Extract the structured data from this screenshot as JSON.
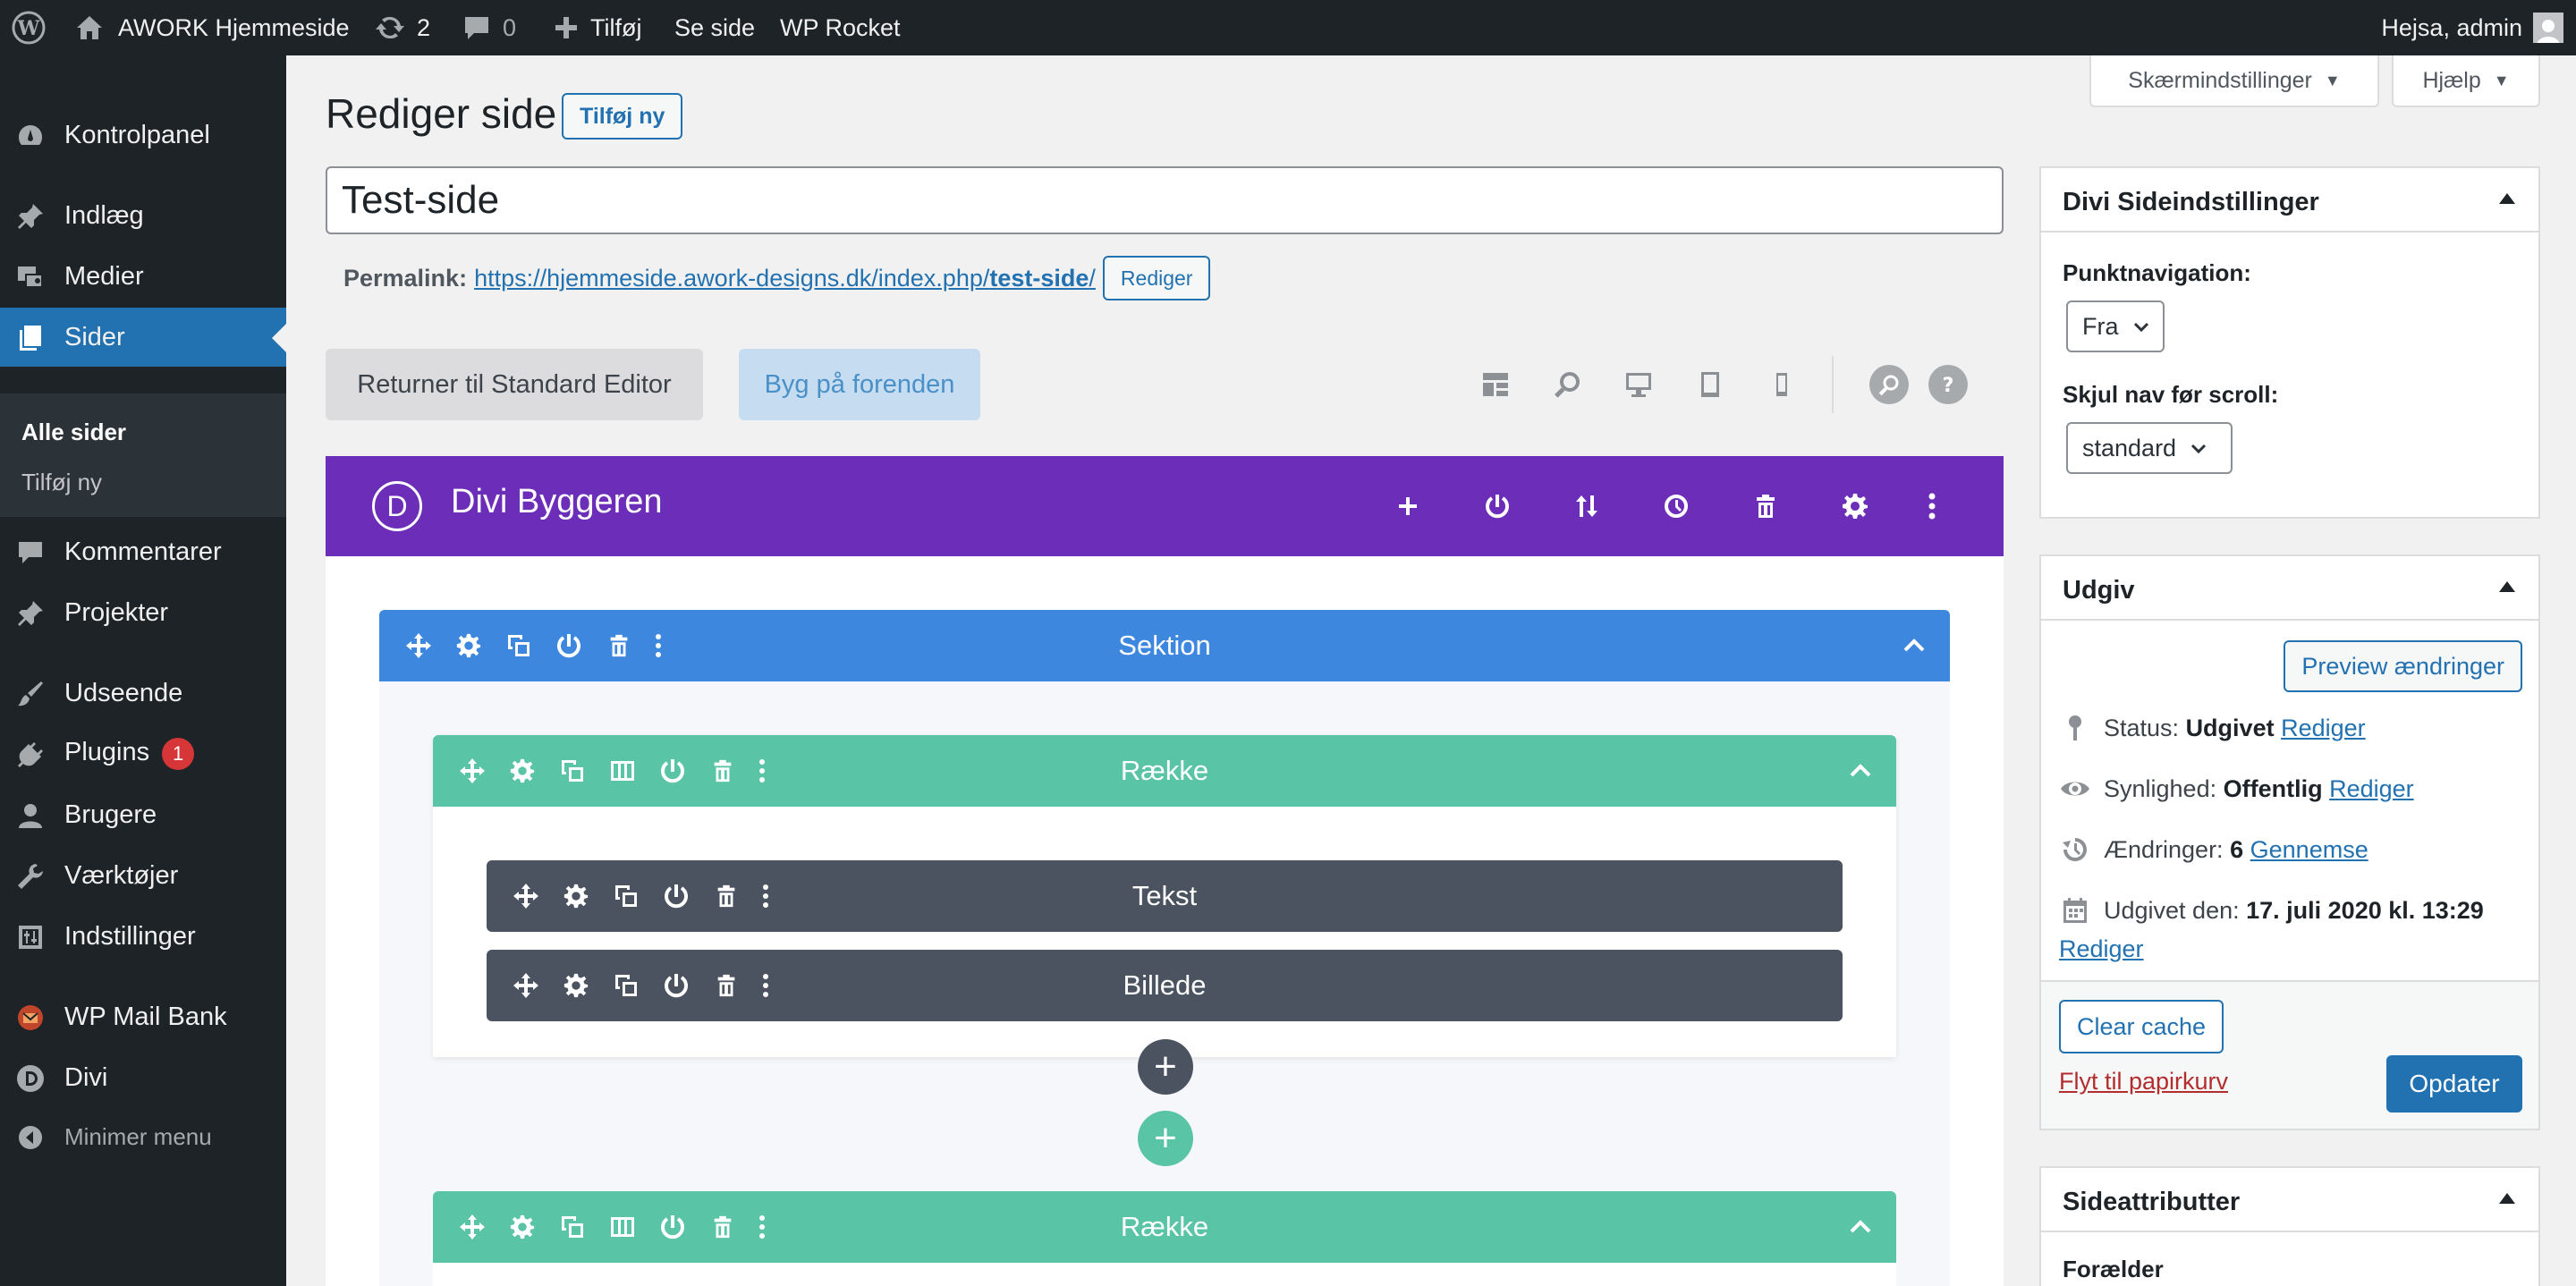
{
  "admin_bar": {
    "site_name": "AWORK Hjemmeside",
    "updates_count": "2",
    "comments_count": "0",
    "new_label": "Tilføj",
    "view_label": "Se side",
    "rocket_label": "WP Rocket",
    "greeting": "Hejsa, admin"
  },
  "menu": {
    "items": [
      {
        "label": "Kontrolpanel",
        "icon": "dashboard-icon"
      },
      {
        "label": "Indlæg",
        "icon": "pin-icon"
      },
      {
        "label": "Medier",
        "icon": "media-icon"
      },
      {
        "label": "Sider",
        "icon": "pages-icon"
      },
      {
        "label": "Kommentarer",
        "icon": "comment-icon"
      },
      {
        "label": "Projekter",
        "icon": "pin-icon"
      },
      {
        "label": "Udseende",
        "icon": "brush-icon"
      },
      {
        "label": "Plugins",
        "icon": "plug-icon",
        "badge": "1"
      },
      {
        "label": "Brugere",
        "icon": "user-icon"
      },
      {
        "label": "Værktøjer",
        "icon": "wrench-icon"
      },
      {
        "label": "Indstillinger",
        "icon": "settings-icon"
      },
      {
        "label": "WP Mail Bank",
        "icon": "mail-bank-icon"
      },
      {
        "label": "Divi",
        "icon": "divi-icon"
      },
      {
        "label": "Minimer menu",
        "icon": "collapse-icon"
      }
    ],
    "submenu": {
      "all_pages": "Alle sider",
      "add_new": "Tilføj ny"
    }
  },
  "header": {
    "screen_options": "Skærmindstillinger",
    "help": "Hjælp",
    "page_title": "Rediger side",
    "add_new": "Tilføj ny"
  },
  "editor": {
    "title_value": "Test-side",
    "permalink_label": "Permalink:",
    "permalink_base": "https://hjemmeside.awork-designs.dk/index.php/",
    "permalink_slug": "test-side",
    "permalink_end": "/",
    "permalink_edit": "Rediger",
    "return_standard": "Returner til Standard Editor",
    "build_frontend": "Byg på forenden"
  },
  "divi": {
    "logo_letter": "D",
    "title": "Divi Byggeren",
    "section_label": "Sektion",
    "row_label": "Række",
    "module_text": "Tekst",
    "module_image": "Billede",
    "add_symbol": "+"
  },
  "sidebar": {
    "divi_settings": {
      "title": "Divi Sideindstillinger",
      "dot_nav_label": "Punktnavigation:",
      "dot_nav_value": "Fra",
      "hide_nav_label": "Skjul nav før scroll:",
      "hide_nav_value": "standard"
    },
    "publish": {
      "title": "Udgiv",
      "preview": "Preview ændringer",
      "status_label": "Status:",
      "status_value": "Udgivet",
      "status_edit": "Rediger",
      "visibility_label": "Synlighed:",
      "visibility_value": "Offentlig",
      "visibility_edit": "Rediger",
      "revisions_label": "Ændringer:",
      "revisions_value": "6",
      "revisions_link": "Gennemse",
      "published_label": "Udgivet den:",
      "published_value": "17. juli 2020 kl. 13:29",
      "published_edit": "Rediger",
      "clear_cache": "Clear cache",
      "trash": "Flyt til papirkurv",
      "update": "Opdater"
    },
    "attributes": {
      "title": "Sideattributter",
      "parent_label": "Forælder"
    }
  },
  "colors": {
    "divi_purple": "#6c2eb9",
    "section_blue": "#3e87de",
    "row_green": "#5ac4a6",
    "module_gray": "#4b5360",
    "wp_blue": "#2271b1",
    "trash_red": "#b32d2e"
  }
}
